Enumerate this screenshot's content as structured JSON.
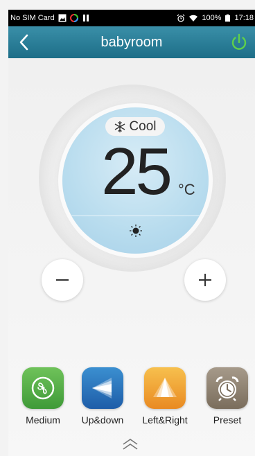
{
  "status_bar": {
    "carrier": "No SIM Card",
    "battery": "100%",
    "time": "17:18"
  },
  "header": {
    "title": "babyroom",
    "back_icon": "chevron-left-icon",
    "power_icon": "power-icon"
  },
  "thermostat": {
    "mode": "Cool",
    "mode_icon": "snowflake-icon",
    "temperature": "25",
    "unit": "°C",
    "light_icon": "light-icon"
  },
  "controls": {
    "minus_icon": "minus-icon",
    "plus_icon": "plus-icon"
  },
  "functions": [
    {
      "label": "Medium",
      "icon": "fan-speed-icon",
      "color": "#4fad45"
    },
    {
      "label": "Up&down",
      "icon": "vertical-swing-icon",
      "color": "#2a73bb"
    },
    {
      "label": "Left&Right",
      "icon": "horizontal-swing-icon",
      "color": "#f0a535"
    },
    {
      "label": "Preset",
      "icon": "alarm-clock-icon",
      "color": "#8c7f6e"
    }
  ],
  "colors": {
    "header": "#2a7d96",
    "power": "#5fd04a"
  }
}
